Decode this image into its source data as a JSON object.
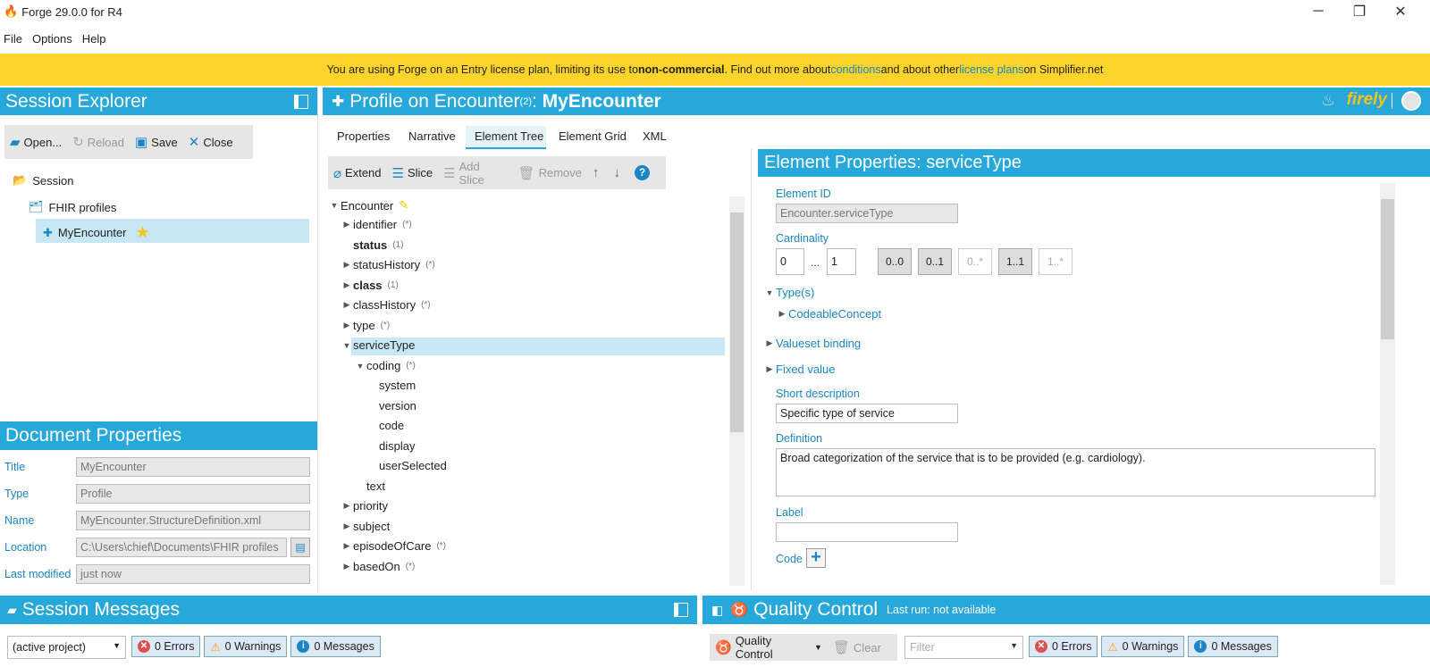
{
  "window": {
    "title": "Forge 29.0.0 for R4",
    "minimize": "─",
    "restore": "❐",
    "close": "✕"
  },
  "menu": [
    "File",
    "Options",
    "Help"
  ],
  "banner": {
    "prefix": "You are using Forge on an Entry license plan, limiting its use to ",
    "bold": "non-commercial",
    "mid": ". Find out more about ",
    "link1": "conditions",
    "mid2": " and about other ",
    "link2": "license plans",
    "suffix": " on Simplifier.net"
  },
  "session_explorer": {
    "title": "Session Explorer",
    "toolbar": {
      "open": "Open...",
      "reload": "Reload",
      "save": "Save",
      "close": "Close"
    },
    "tree": {
      "session": "Session",
      "folder": "FHIR profiles",
      "profile": "MyEncounter"
    }
  },
  "document_properties": {
    "title": "Document Properties",
    "fields": [
      {
        "label": "Title",
        "value": "MyEncounter"
      },
      {
        "label": "Type",
        "value": "Profile"
      },
      {
        "label": "Name",
        "value": "MyEncounter.StructureDefinition.xml"
      },
      {
        "label": "Location",
        "value": "C:\\Users\\chief\\Documents\\FHIR profiles"
      },
      {
        "label": "Last modified",
        "value": "just now"
      }
    ]
  },
  "profile_header": {
    "prefix": "Profile on Encounter",
    "sup": "(2)",
    "sep": ": ",
    "name": "MyEncounter",
    "brand": "firely"
  },
  "tabs": [
    "Properties",
    "Narrative",
    "Element Tree",
    "Element Grid",
    "XML"
  ],
  "element_toolbar": {
    "extend": "Extend",
    "slice": "Slice",
    "add_slice": "Add Slice",
    "remove": "Remove",
    "help": "?"
  },
  "tree": [
    {
      "label": "Encounter",
      "card": ""
    },
    {
      "label": "identifier",
      "card": "(*)"
    },
    {
      "label": "status",
      "card": "(1)"
    },
    {
      "label": "statusHistory",
      "card": "(*)"
    },
    {
      "label": "class",
      "card": "(1)"
    },
    {
      "label": "classHistory",
      "card": "(*)"
    },
    {
      "label": "type",
      "card": "(*)"
    },
    {
      "label": "serviceType",
      "card": ""
    },
    {
      "label": "coding",
      "card": "(*)"
    },
    {
      "label": "system",
      "card": ""
    },
    {
      "label": "version",
      "card": ""
    },
    {
      "label": "code",
      "card": ""
    },
    {
      "label": "display",
      "card": ""
    },
    {
      "label": "userSelected",
      "card": ""
    },
    {
      "label": "text",
      "card": ""
    },
    {
      "label": "priority",
      "card": ""
    },
    {
      "label": "subject",
      "card": ""
    },
    {
      "label": "episodeOfCare",
      "card": "(*)"
    },
    {
      "label": "basedOn",
      "card": "(*)"
    }
  ],
  "element_properties": {
    "title": "Element Properties: serviceType",
    "element_id_label": "Element ID",
    "element_id": "Encounter.serviceType",
    "cardinality_label": "Cardinality",
    "min": "0",
    "range_sep": "...",
    "max": "1",
    "presets": [
      "0..0",
      "0..1",
      "0..*",
      "1..1",
      "1..*"
    ],
    "types_label": "Type(s)",
    "type_value": "CodeableConcept",
    "valueset_label": "Valueset binding",
    "fixed_label": "Fixed value",
    "short_label": "Short description",
    "short_value": "Specific type of service",
    "definition_label": "Definition",
    "definition_value": "Broad categorization of the service that is to be provided (e.g. cardiology).",
    "label_label": "Label",
    "label_value": "",
    "code_label": "Code"
  },
  "session_messages": {
    "title": "Session Messages",
    "filter": "(active project)",
    "errors": "0 Errors",
    "warnings": "0 Warnings",
    "messages": "0 Messages"
  },
  "quality_control": {
    "title": "Quality Control",
    "last_run": "Last run: not available",
    "button": "Quality Control",
    "clear": "Clear",
    "filter_placeholder": "Filter",
    "errors": "0 Errors",
    "warnings": "0 Warnings",
    "messages": "0 Messages"
  }
}
